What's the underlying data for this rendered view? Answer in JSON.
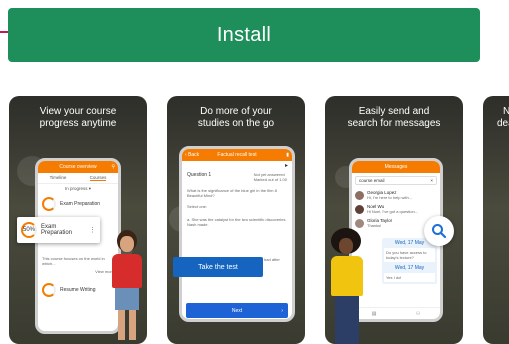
{
  "install": {
    "label": "Install"
  },
  "cards": [
    {
      "caption_line1": "View your course",
      "caption_line2": "progress anytime",
      "app_title": "Course overview",
      "tabs": [
        "Timeline",
        "Courses"
      ],
      "filter": "In progress",
      "items": [
        "Exam Preparation",
        "Resume Writing"
      ],
      "popup": "Exam Preparation",
      "popup_percent": "50%",
      "note": "This course focuses on the world in which...",
      "link": "View more"
    },
    {
      "caption_line1": "Do more of your",
      "caption_line2": "studies on the go",
      "back": "Back",
      "app_title": "Factual recall test",
      "question": "Question 1",
      "status1": "Not yet answered",
      "status2": "Marked out of 1.00",
      "q_text": "What is the significance of the blue girl in the film 8 Beautiful Mind?",
      "select": "Select one:",
      "option_a": "a. She was the catalyst for the two scientific discoveries Nash made.",
      "option_b": "b. She was the woman Nash had after getting close",
      "cta": "Take the test",
      "next": "Next"
    },
    {
      "caption_line1": "Easily send and",
      "caption_line2": "search for messages",
      "app_title": "Messages",
      "search": "course email",
      "contacts": [
        {
          "name": "Georgia Lopez",
          "text": "Hi, I'm here to help with..."
        },
        {
          "name": "Noel Wu",
          "text": "Hi Noel, I've got a question..."
        },
        {
          "name": "Gloria Taylor",
          "text": "Thanks!"
        }
      ],
      "date1": "Wed, 17 May",
      "msg1": "Do you have access to today's lecture?",
      "date2": "Wed, 17 May",
      "msg2": "Yes I do!"
    },
    {
      "caption_line1": "N",
      "caption_line2": "dea"
    }
  ],
  "colors": {
    "install_green": "#1e8e5a",
    "orange": "#f57c00",
    "blue": "#1565c0"
  }
}
